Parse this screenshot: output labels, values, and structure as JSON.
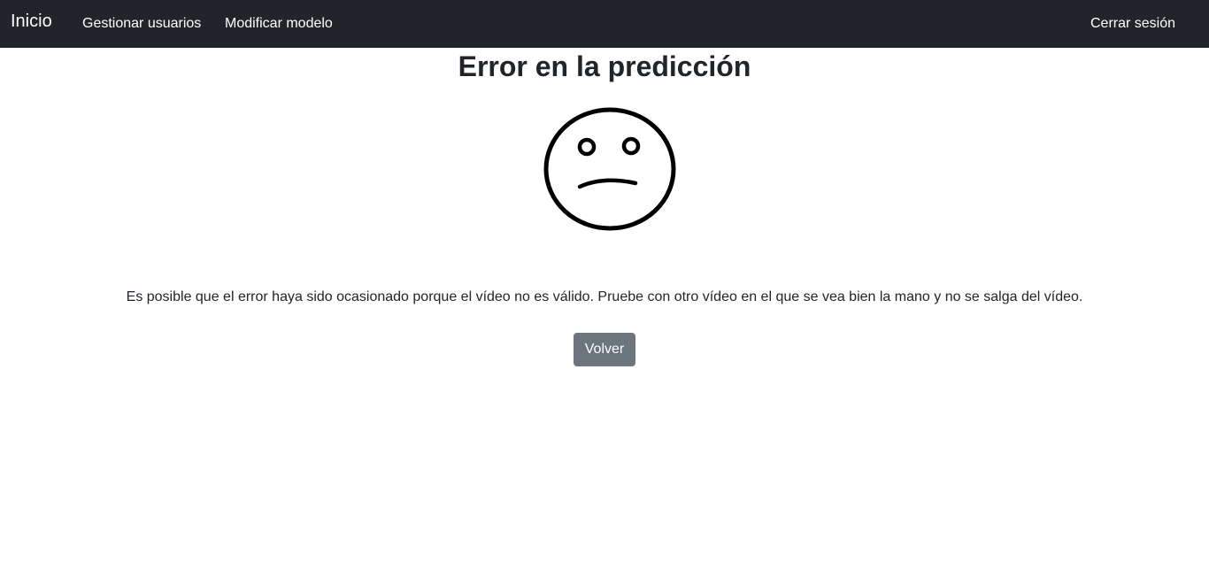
{
  "navbar": {
    "brand": "Inicio",
    "links": [
      {
        "label": "Gestionar usuarios"
      },
      {
        "label": "Modificar modelo"
      }
    ],
    "logout_label": "Cerrar sesión"
  },
  "main": {
    "title": "Error en la predicción",
    "face_icon": "sad-face-icon",
    "message": "Es posible que el error haya sido ocasionado porque el vídeo no es válido. Pruebe con otro vídeo en el que se vea bien la mano y no se salga del vídeo.",
    "back_button_label": "Volver"
  },
  "colors": {
    "navbar_bg": "#212529",
    "button_bg": "#6c757d",
    "text": "#212529"
  }
}
